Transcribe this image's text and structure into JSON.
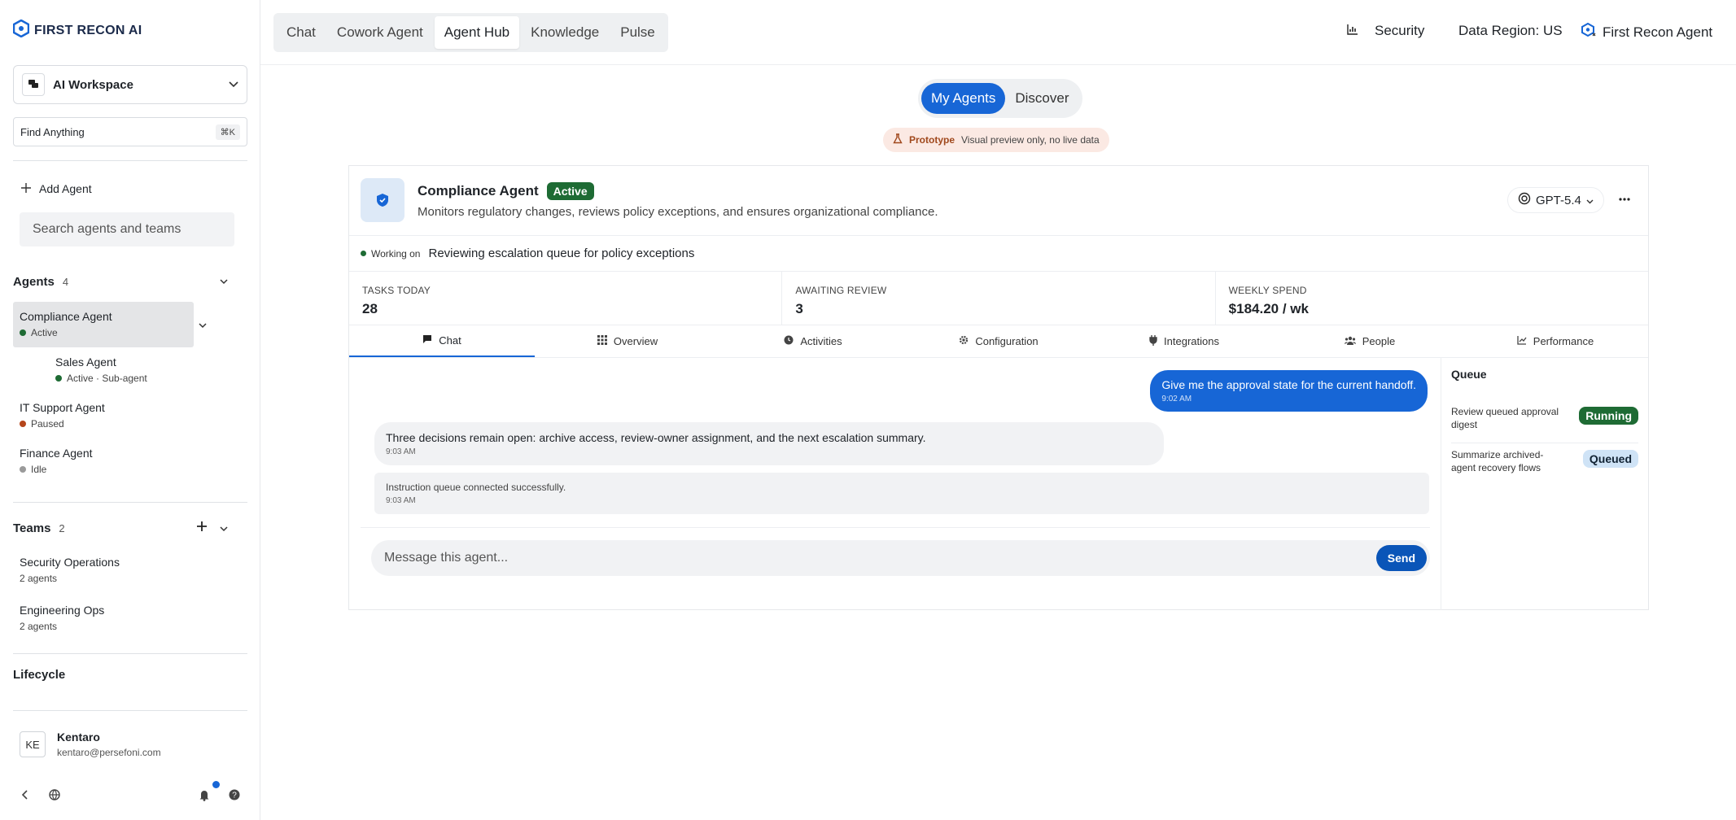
{
  "brand": {
    "name": "FIRST RECON AI"
  },
  "workspace": {
    "label": "AI Workspace"
  },
  "find": {
    "label": "Find Anything",
    "shortcut": "⌘K"
  },
  "sidebar": {
    "add_agent": "Add Agent",
    "search_placeholder": "Search agents and teams",
    "agents_title": "Agents",
    "agents_count": "4",
    "agents": [
      {
        "name": "Compliance Agent",
        "status": "Active",
        "status_color": "#1e6b34"
      },
      {
        "name": "Sales Agent",
        "status": "Active · Sub-agent",
        "status_color": "#1e6b34"
      },
      {
        "name": "IT Support Agent",
        "status": "Paused",
        "status_color": "#b5461b"
      },
      {
        "name": "Finance Agent",
        "status": "Idle",
        "status_color": "#9a9a9a"
      }
    ],
    "teams_title": "Teams",
    "teams_count": "2",
    "teams": [
      {
        "name": "Security Operations",
        "sub": "2 agents"
      },
      {
        "name": "Engineering Ops",
        "sub": "2 agents"
      }
    ],
    "lifecycle_title": "Lifecycle",
    "user": {
      "initials": "KE",
      "name": "Kentaro",
      "email": "kentaro@persefoni.com"
    }
  },
  "topbar": {
    "tabs": [
      "Chat",
      "Cowork Agent",
      "Agent Hub",
      "Knowledge",
      "Pulse"
    ],
    "active_tab": "Agent Hub",
    "security": "Security",
    "region": "Data Region: US",
    "agent_menu": "First Recon Agent"
  },
  "segment": {
    "my_agents": "My Agents",
    "discover": "Discover"
  },
  "prototype": {
    "tag": "Prototype",
    "text": "Visual preview only, no live data"
  },
  "agent": {
    "name": "Compliance Agent",
    "status": "Active",
    "description": "Monitors regulatory changes, reviews policy exceptions, and ensures organizational compliance.",
    "model": "GPT-5.4",
    "working_label": "Working on",
    "working_text": "Reviewing escalation queue for policy exceptions",
    "stats": [
      {
        "label": "TASKS TODAY",
        "value": "28"
      },
      {
        "label": "AWAITING REVIEW",
        "value": "3"
      },
      {
        "label": "WEEKLY SPEND",
        "value": "$184.20 / wk"
      }
    ],
    "tabs": [
      "Chat",
      "Overview",
      "Activities",
      "Configuration",
      "Integrations",
      "People",
      "Performance"
    ]
  },
  "chat": {
    "user_msg": "Give me the approval state for the current handoff.",
    "user_time": "9:02 AM",
    "agent_msg": "Three decisions remain open: archive access, review-owner assignment, and the next escalation summary.",
    "agent_time": "9:03 AM",
    "system_msg": "Instruction queue connected successfully.",
    "system_time": "9:03 AM",
    "placeholder": "Message this agent...",
    "send": "Send"
  },
  "queue": {
    "title": "Queue",
    "items": [
      {
        "text": "Review queued approval digest",
        "status": "Running"
      },
      {
        "text": "Summarize archived-agent recovery flows",
        "status": "Queued"
      }
    ]
  },
  "colors": {
    "accent": "#1766d6",
    "active_green": "#1e6b34",
    "paused": "#b5461b"
  }
}
